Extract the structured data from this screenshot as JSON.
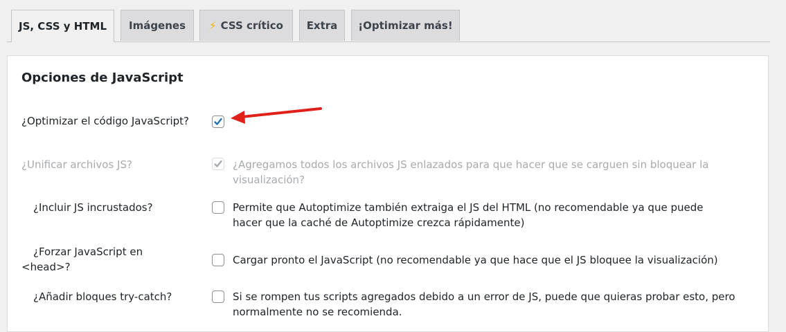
{
  "tabs": [
    {
      "label": "JS, CSS y HTML",
      "active": true
    },
    {
      "label": "Imágenes",
      "active": false
    },
    {
      "label": "CSS crítico",
      "active": false,
      "icon": "lightning-icon"
    },
    {
      "label": "Extra",
      "active": false
    },
    {
      "label": "¡Optimizar más!",
      "active": false
    }
  ],
  "section": {
    "title": "Opciones de JavaScript"
  },
  "options": [
    {
      "label": "¿Optimizar el código JavaScript?",
      "checked": true,
      "disabled": false,
      "description": ""
    },
    {
      "label": "¿Unificar archivos JS?",
      "checked": true,
      "disabled": true,
      "description_line1": "¿Agregamos todos los archivos JS enlazados para que hacer que se carguen sin bloquear la",
      "description_line2": "visualización?"
    },
    {
      "label": "¿Incluir JS incrustados?",
      "checked": false,
      "disabled": false,
      "description_line1": "Permite que Autoptimize también extraiga el JS del HTML (no recomendable ya que puede",
      "description_line2": "hacer que la caché de Autoptimize crezca rápidamente)"
    },
    {
      "label_line1": "¿Forzar JavaScript en",
      "label_line2": "<head>?",
      "checked": false,
      "disabled": false,
      "description": "Cargar pronto el JavaScript (no recomendable ya que hace que el JS bloquee la visualización)"
    },
    {
      "label": "¿Añadir bloques try-catch?",
      "checked": false,
      "disabled": false,
      "description_line1": "Si se rompen tus scripts agregados debido a un error de JS, puede que quieras probar esto, pero",
      "description_line2": "normalmente no se recomienda."
    }
  ],
  "colors": {
    "checkmark": "#2271b1",
    "checkmark_disabled": "#a7aaad",
    "annotation_arrow": "#e0201b"
  }
}
